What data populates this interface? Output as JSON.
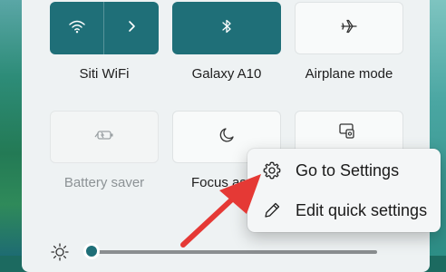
{
  "quick_settings": {
    "tiles": [
      {
        "id": "wifi",
        "label": "Siti WiFi",
        "state": "on",
        "icon": "wifi-icon",
        "expand_icon": "chevron-right-icon"
      },
      {
        "id": "bluetooth",
        "label": "Galaxy A10",
        "state": "on",
        "icon": "bluetooth-icon"
      },
      {
        "id": "airplane",
        "label": "Airplane mode",
        "state": "off",
        "icon": "airplane-icon"
      },
      {
        "id": "battery",
        "label": "Battery saver",
        "state": "disabled",
        "icon": "battery-saver-icon"
      },
      {
        "id": "focus",
        "label": "Focus ass",
        "state": "off",
        "icon": "moon-icon"
      },
      {
        "id": "cast",
        "label": "",
        "state": "off",
        "icon": "cast-icon"
      }
    ],
    "brightness": {
      "icon": "sun-icon",
      "level_percent": 2
    }
  },
  "context_menu": {
    "items": [
      {
        "label": "Go to Settings",
        "icon": "gear-icon"
      },
      {
        "label": "Edit quick settings",
        "icon": "pencil-icon"
      }
    ]
  },
  "colors": {
    "accent": "#1f6f78",
    "panel": "#eef2f3",
    "annotation_arrow": "#e53935"
  }
}
